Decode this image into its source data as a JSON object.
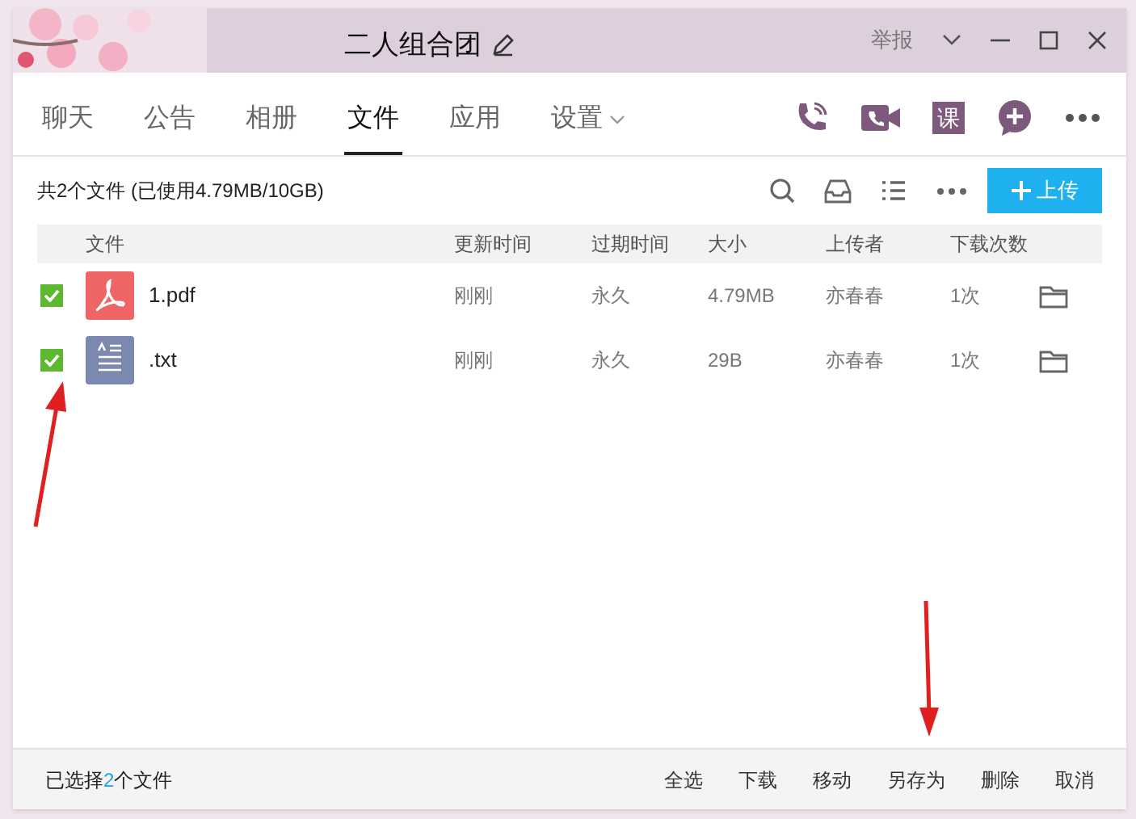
{
  "window": {
    "title": "二人组合团",
    "report": "举报"
  },
  "tabs": [
    {
      "label": "聊天",
      "selected": false,
      "dropdown": false
    },
    {
      "label": "公告",
      "selected": false,
      "dropdown": false
    },
    {
      "label": "相册",
      "selected": false,
      "dropdown": false
    },
    {
      "label": "文件",
      "selected": true,
      "dropdown": false
    },
    {
      "label": "应用",
      "selected": false,
      "dropdown": false
    },
    {
      "label": "设置",
      "selected": false,
      "dropdown": true
    }
  ],
  "header_icons": [
    {
      "kind": "phone"
    },
    {
      "kind": "video"
    },
    {
      "kind": "lesson",
      "text": "课"
    },
    {
      "kind": "plus"
    },
    {
      "kind": "more"
    }
  ],
  "summary": "共2个文件 (已使用4.79MB/10GB)",
  "upload_button": "上传",
  "table": {
    "columns": [
      "文件",
      "更新时间",
      "过期时间",
      "大小",
      "上传者",
      "下载次数"
    ],
    "rows": [
      {
        "checked": true,
        "kind": "pdf",
        "name": "1.pdf",
        "updated": "刚刚",
        "expires": "永久",
        "size": "4.79MB",
        "uploader": "亦春春",
        "downloads": "1次"
      },
      {
        "checked": true,
        "kind": "txt",
        "name": ".txt",
        "updated": "刚刚",
        "expires": "永久",
        "size": "29B",
        "uploader": "亦春春",
        "downloads": "1次"
      }
    ]
  },
  "status_bar": {
    "prefix": "已选择",
    "count": "2",
    "suffix": "个文件",
    "actions": [
      "全选",
      "下载",
      "移动",
      "另存为",
      "删除",
      "取消"
    ]
  }
}
